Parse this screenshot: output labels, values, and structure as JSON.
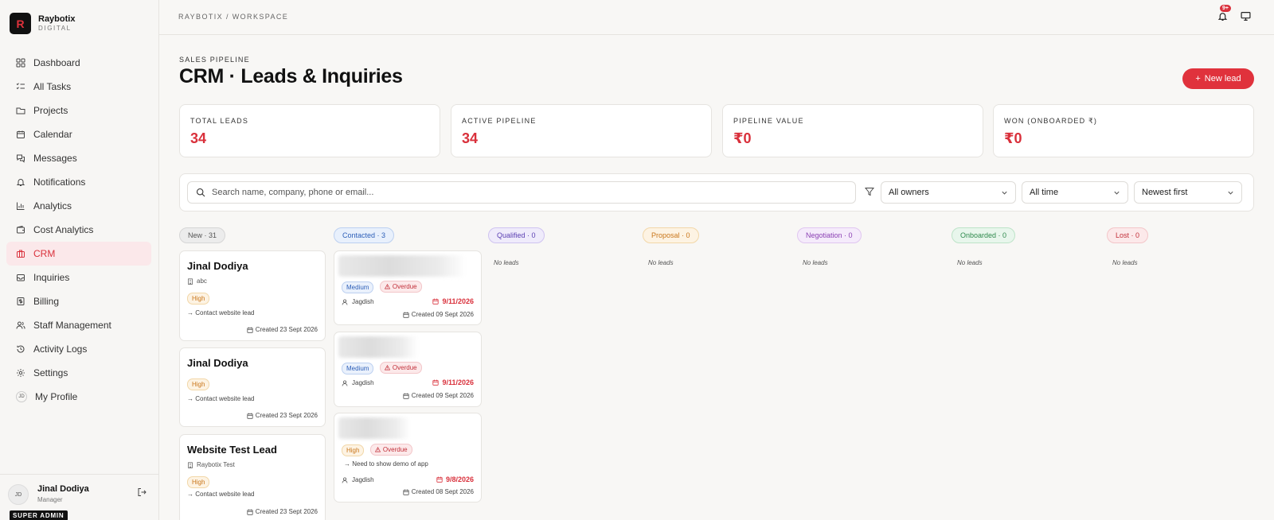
{
  "brand": {
    "logo_letter": "R",
    "name": "Raybotix",
    "subtitle": "DIGITAL"
  },
  "sidebar": {
    "items": [
      {
        "label": "Dashboard",
        "icon": "dashboard-icon"
      },
      {
        "label": "All Tasks",
        "icon": "list-checks-icon"
      },
      {
        "label": "Projects",
        "icon": "folder-icon"
      },
      {
        "label": "Calendar",
        "icon": "calendar-icon"
      },
      {
        "label": "Messages",
        "icon": "messages-icon"
      },
      {
        "label": "Notifications",
        "icon": "bell-icon"
      },
      {
        "label": "Analytics",
        "icon": "bar-chart-icon"
      },
      {
        "label": "Cost Analytics",
        "icon": "wallet-icon"
      },
      {
        "label": "CRM",
        "icon": "briefcase-icon",
        "active": true
      },
      {
        "label": "Inquiries",
        "icon": "inbox-icon"
      },
      {
        "label": "Billing",
        "icon": "receipt-icon"
      },
      {
        "label": "Staff Management",
        "icon": "users-icon"
      },
      {
        "label": "Activity Logs",
        "icon": "history-icon"
      },
      {
        "label": "Settings",
        "icon": "gear-icon"
      },
      {
        "label": "My Profile",
        "icon": "profile-avatar-icon",
        "initials": "JD"
      }
    ],
    "user": {
      "initials": "JD",
      "name": "Jinal Dodiya",
      "role": "Manager",
      "badge": "SUPER ADMIN"
    }
  },
  "topbar": {
    "breadcrumb": "RAYBOTIX / WORKSPACE",
    "notification_count": "9+"
  },
  "header": {
    "eyebrow": "SALES PIPELINE",
    "title": "CRM · Leads & Inquiries",
    "new_lead_label": "New lead"
  },
  "stats": [
    {
      "label": "TOTAL LEADS",
      "value": "34"
    },
    {
      "label": "ACTIVE PIPELINE",
      "value": "34"
    },
    {
      "label": "PIPELINE VALUE",
      "value": "₹0"
    },
    {
      "label": "WON (ONBOARDED ₹)",
      "value": "₹0"
    }
  ],
  "filters": {
    "search_placeholder": "Search name, company, phone or email...",
    "owner": "All owners",
    "time": "All time",
    "sort": "Newest first"
  },
  "columns": [
    {
      "label": "New · 31",
      "color": "#555555",
      "bg": "#ececec",
      "border": "#d6d6d6"
    },
    {
      "label": "Contacted · 3",
      "color": "#2d5fb8",
      "bg": "#e8f0fc",
      "border": "#bcd0f0"
    },
    {
      "label": "Qualified · 0",
      "color": "#5b3fb3",
      "bg": "#efebfb",
      "border": "#cfc3f0"
    },
    {
      "label": "Proposal · 0",
      "color": "#c9761a",
      "bg": "#fdf3e3",
      "border": "#f2d7a8"
    },
    {
      "label": "Negotiation · 0",
      "color": "#8a3fb3",
      "bg": "#f5ebfb",
      "border": "#e0c6f0"
    },
    {
      "label": "Onboarded · 0",
      "color": "#2f8a4d",
      "bg": "#e8f6ec",
      "border": "#bde3c8"
    },
    {
      "label": "Lost · 0",
      "color": "#c2303a",
      "bg": "#fce9ea",
      "border": "#f3c6c9"
    }
  ],
  "empty_label": "No leads",
  "new_cards": [
    {
      "name": "Jinal Dodiya",
      "company": "abc",
      "priority": "High",
      "note": "→ Contact website lead",
      "created": "Created 23 Sept 2026"
    },
    {
      "name": "Jinal Dodiya",
      "priority": "High",
      "note": "→ Contact website lead",
      "created": "Created 23 Sept 2026"
    },
    {
      "name": "Website Test Lead",
      "company": "Raybotix Test",
      "priority": "High",
      "note": "→ Contact website lead",
      "created": "Created 23 Sept 2026"
    }
  ],
  "contacted_cards": [
    {
      "priority": "Medium",
      "status": "Overdue",
      "owner": "Jagdish",
      "due": "9/11/2026",
      "created": "Created 09 Sept 2026"
    },
    {
      "priority": "Medium",
      "status": "Overdue",
      "owner": "Jagdish",
      "due": "9/11/2026",
      "created": "Created 09 Sept 2026"
    },
    {
      "priority": "High",
      "status": "Overdue",
      "note": "→ Need to show demo of app",
      "owner": "Jagdish",
      "due": "9/8/2026",
      "created": "Created 08 Sept 2026"
    }
  ]
}
